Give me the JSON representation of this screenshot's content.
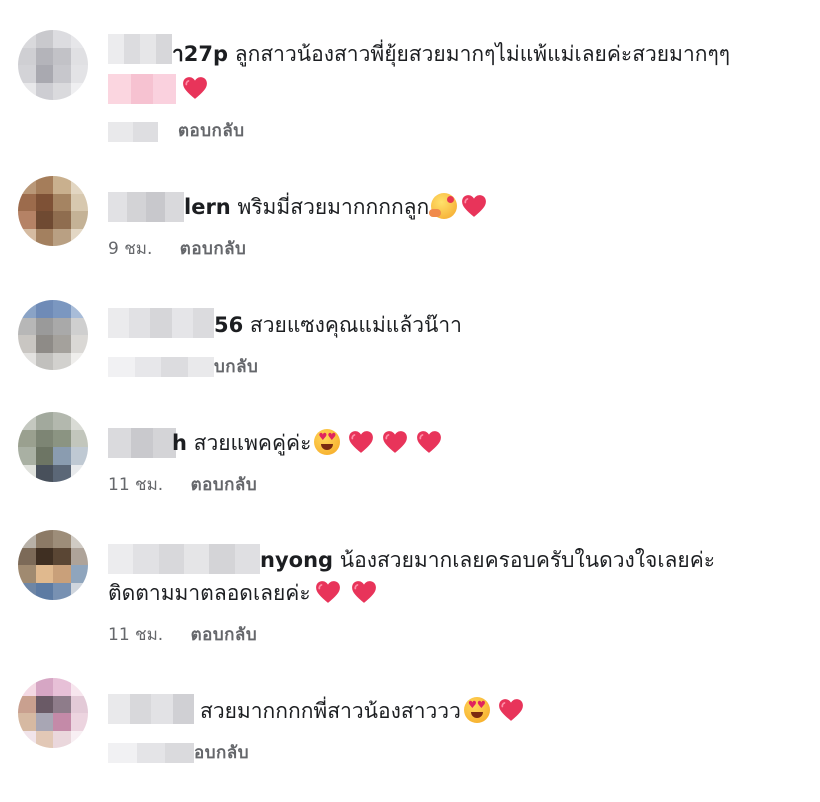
{
  "comments": [
    {
      "name_visible": "า27p",
      "text_line1": "ลูกสาวน้องสาวพี่ยุ้ยสวยมากๆไม่แพ้แม่เลยค่ะสวยมากๆๆ",
      "time": "",
      "reply": "ตอบกลับ",
      "emojis": [
        "red-heart"
      ]
    },
    {
      "name_visible": "lern",
      "text_line1": "พริมมี่สวยมากกกกลูก",
      "time": "9 ชม.",
      "reply": "ตอบกลับ",
      "emojis": [
        "smiling-face-with-hearts",
        "red-heart"
      ]
    },
    {
      "name_visible": "56",
      "text_line1": "สวยแซงคุณแม่แล้วน๊าา",
      "time": "",
      "reply": "บกลับ",
      "emojis": []
    },
    {
      "name_visible": "h",
      "text_line1": "สวยแพคคู่ค่ะ",
      "time": "11 ชม.",
      "reply": "ตอบกลับ",
      "emojis": [
        "heart-eyes",
        "red-heart",
        "red-heart",
        "red-heart"
      ]
    },
    {
      "name_visible": "nyong",
      "text_line1": "น้องสวยมากเลยครอบครับในดวงใจเลยค่ะ",
      "text_line2": "ติดตามมาตลอดเลยค่ะ",
      "time": "11 ชม.",
      "reply": "ตอบกลับ",
      "emojis": [
        "red-heart",
        "red-heart"
      ]
    },
    {
      "name_visible": "",
      "text_line1": "สวยมากกกกพี่สาวน้องสาววว",
      "time": "",
      "reply": "อบกลับ",
      "emojis": [
        "heart-eyes",
        "sparkling-heart"
      ]
    }
  ],
  "colors": {
    "text": "#1c1e21",
    "meta": "#65676b",
    "heart": "#e8345a"
  }
}
